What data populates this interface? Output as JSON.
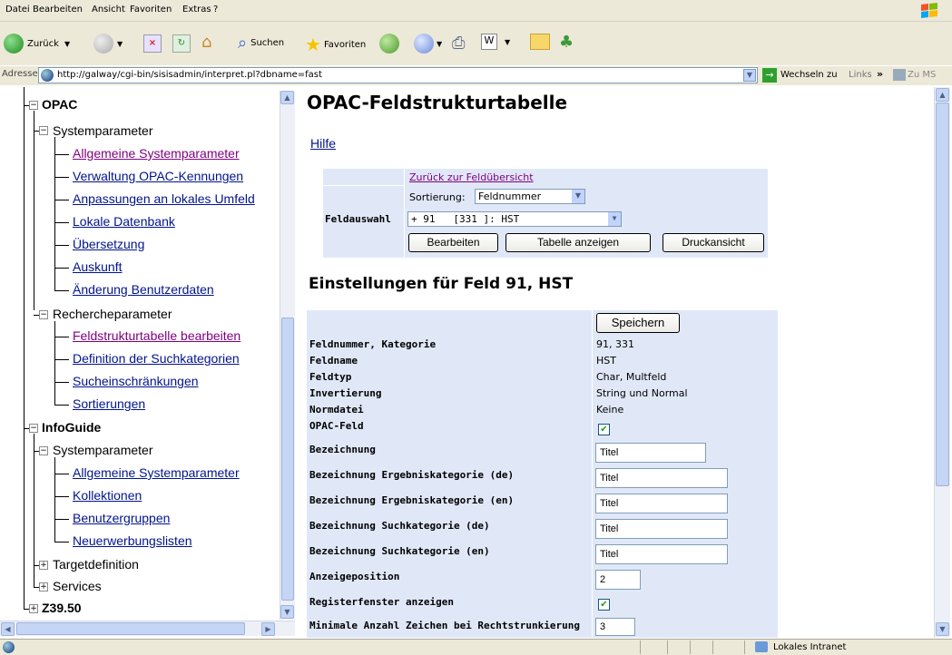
{
  "menu": [
    "Datei",
    "Bearbeiten",
    "Ansicht",
    "Favoriten",
    "Extras",
    "?"
  ],
  "toolbar": {
    "back": "Zurück",
    "search": "Suchen",
    "favorites": "Favoriten"
  },
  "address": {
    "label": "Adresse",
    "url": "http://galway/cgi-bin/sisisadmin/interpret.pl?dbname=fast",
    "go": "Wechseln zu",
    "links": "Links",
    "links_more": "»",
    "zums": "Zu MS"
  },
  "tree": {
    "opac": "OPAC",
    "sys": "Systemparameter",
    "sys_items": [
      "Allgemeine Systemparameter",
      "Verwaltung OPAC-Kennungen",
      "Anpassungen an lokales Umfeld",
      "Lokale Datenbank",
      "Übersetzung",
      "Auskunft",
      "Änderung Benutzerdaten"
    ],
    "rech": "Rechercheparameter",
    "rech_items": [
      "Feldstrukturtabelle bearbeiten",
      "Definition der Suchkategorien",
      "Sucheinschränkungen",
      "Sortierungen"
    ],
    "infoguide": "InfoGuide",
    "ig_sys": "Systemparameter",
    "ig_items": [
      "Allgemeine Systemparameter",
      "Kollektionen",
      "Benutzergruppen",
      "Neuerwerbungslisten"
    ],
    "target": "Targetdefinition",
    "services": "Services",
    "z3950": "Z39.50"
  },
  "main": {
    "title": "OPAC-Feldstrukturtabelle",
    "help": "Hilfe",
    "back_link": "Zurück zur Feldübersicht",
    "sort_label": "Sortierung:",
    "sort_value": "Feldnummer",
    "field_select_label": "Feldauswahl",
    "field_select_value": "+ 91   [331 ]: HST",
    "btn_edit": "Bearbeiten",
    "btn_table": "Tabelle anzeigen",
    "btn_print": "Druckansicht",
    "settings_title": "Einstellungen für Feld 91, HST",
    "save": "Speichern",
    "rows": [
      {
        "label": "Feldnummer, Kategorie",
        "value": "91, 331"
      },
      {
        "label": "Feldname",
        "value": "HST"
      },
      {
        "label": "Feldtyp",
        "value": "Char, Multfeld"
      },
      {
        "label": "Invertierung",
        "value": "String und Normal"
      },
      {
        "label": "Normdatei",
        "value": "Keine"
      },
      {
        "label": "OPAC-Feld",
        "value": "checked"
      },
      {
        "label": "Bezeichnung",
        "value": "Titel"
      },
      {
        "label": "Bezeichnung Ergebniskategorie (de)",
        "value": "Titel"
      },
      {
        "label": "Bezeichnung Ergebniskategorie (en)",
        "value": "Titel"
      },
      {
        "label": "Bezeichnung Suchkategorie (de)",
        "value": "Titel"
      },
      {
        "label": "Bezeichnung Suchkategorie (en)",
        "value": "Titel"
      },
      {
        "label": "Anzeigeposition",
        "value": "2"
      },
      {
        "label": "Registerfenster anzeigen",
        "value": "checked"
      },
      {
        "label": "Minimale Anzahl Zeichen bei Rechtstrunkierung",
        "value": "3"
      }
    ]
  },
  "status": {
    "zone": "Lokales Intranet"
  }
}
